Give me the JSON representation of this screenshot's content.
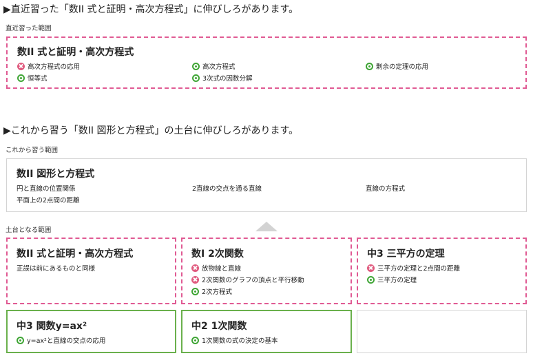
{
  "recent": {
    "headline": "▶直近習った「数II 式と証明・高次方程式」に伸びしろがあります。",
    "caption": "直近習った範囲",
    "box": {
      "title": "数II 式と証明・高次方程式",
      "items": [
        {
          "label": "高次方程式の応用",
          "status": "ng"
        },
        {
          "label": "高次方程式",
          "status": "ok"
        },
        {
          "label": "剰余の定理の応用",
          "status": "ok"
        },
        {
          "label": "恒等式",
          "status": "ok"
        },
        {
          "label": "3次式の因数分解",
          "status": "ok"
        }
      ]
    }
  },
  "upcoming": {
    "headline": "▶これから習う「数II 図形と方程式」の土台に伸びしろがあります。",
    "caption": "これから習う範囲",
    "box": {
      "title": "数II 図形と方程式",
      "topics": [
        "円と直線の位置関係",
        "2直線の交点を通る直線",
        "直線の方程式",
        "平面上の2点間の距離"
      ]
    }
  },
  "foundation": {
    "caption": "土台となる範囲",
    "cards": [
      {
        "title": "数II 式と証明・高次方程式",
        "note": "正誤は前にあるものと同様",
        "items": []
      },
      {
        "title": "数I 2次関数",
        "items": [
          {
            "label": "放物線と直線",
            "status": "ng"
          },
          {
            "label": "2次関数のグラフの頂点と平行移動",
            "status": "ng"
          },
          {
            "label": "2次方程式",
            "status": "ok"
          }
        ]
      },
      {
        "title": "中3 三平方の定理",
        "items": [
          {
            "label": "三平方の定理と2点間の距離",
            "status": "ng"
          },
          {
            "label": "三平方の定理",
            "status": "ok"
          }
        ]
      },
      {
        "title": "中3 関数y=ax²",
        "items": [
          {
            "label": "y=ax²と直線の交点の応用",
            "status": "ok"
          }
        ]
      },
      {
        "title": "中2 1次関数",
        "items": [
          {
            "label": "1次関数の式の決定の基本",
            "status": "ok"
          }
        ]
      }
    ]
  },
  "colors": {
    "weak_border": "#e05a93",
    "strong_border": "#6ab04c",
    "ok_icon": "#3fa535",
    "ng_icon": "#e05a7e"
  },
  "icons": {
    "ok": "check-circle-icon",
    "ng": "cross-circle-icon"
  }
}
